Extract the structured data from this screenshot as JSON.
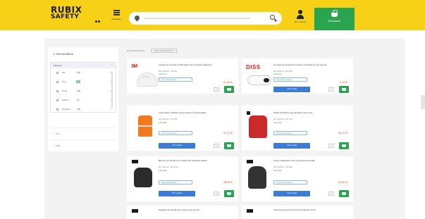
{
  "brand": {
    "line1": "RUBIX",
    "line2": "SAFETY"
  },
  "header": {
    "catalog_label": "Catalogue",
    "account_label": "Mon compte",
    "cart_label": "Mon panier"
  },
  "colors": {
    "header_bg": "#f7d117",
    "accent_green": "#2aa44f",
    "link_blue": "#3c7bd6",
    "price_red": "#e05030"
  },
  "filters": {
    "title": "Trier les filtres",
    "group_label": "Marques",
    "options": [
      {
        "label": "3M",
        "count": "12",
        "highlight": false
      },
      {
        "label": "Diss",
        "count": "8",
        "highlight": true
      },
      {
        "label": "Delta",
        "count": "14",
        "highlight": false
      },
      {
        "label": "Kapriol",
        "count": "6",
        "highlight": false
      },
      {
        "label": "Portwest",
        "count": "21",
        "highlight": false
      }
    ],
    "collapsed": [
      "Prix",
      "Taille"
    ]
  },
  "sortbar": {
    "results": "32 produits trouvés",
    "sort": "Trier par pertinence ▾"
  },
  "products": [
    {
      "brand": "3M",
      "title": "Casque de sécurité ventilé blanc avec lunettes intégrées",
      "sub": "Réf. fabricant : 3M-V9A",
      "stock": "En stock",
      "tag": "Voir la fiche produit",
      "price": "31,56 €",
      "detail": "Voir le détail",
      "qty": "1"
    },
    {
      "brand": "DISS",
      "title": "Lunettes de protection incolores anti-buée et anti-rayures",
      "sub": "Réf. fabricant : DS-0201",
      "stock": "En stock",
      "tag": "Voir la fiche produit",
      "price": "4,92 €",
      "detail": "Voir le détail",
      "qty": "1"
    },
    {
      "brand": "",
      "title": "Veste haute visibilité orange classe 3 imperméable",
      "sub": "Réf. fabricant : HV-3310",
      "stock": "En stock",
      "tag": "Voir la fiche produit",
      "price": "41,23 €",
      "detail": "Voir le détail",
      "qty": "1"
    },
    {
      "brand": "",
      "title": "Parka softshell rouge doublée coupe-vent",
      "sub": "Réf. fabricant : PK-7721",
      "stock": "En stock",
      "tag": "Voir la fiche produit",
      "price": "56,10 €",
      "detail": "Voir le détail",
      "qty": "1"
    },
    {
      "brand": "",
      "title": "Blouson de travail noir multipoches doublure polaire",
      "sub": "Réf. fabricant : BW-1140",
      "stock": "En stock",
      "tag": "Voir la fiche produit",
      "price": "48,95 €",
      "detail": "Voir le détail",
      "qty": "1"
    },
    {
      "brand": "",
      "title": "Veste matelassée noire à capuche amovible",
      "sub": "Réf. fabricant : VM-2290",
      "stock": "En stock",
      "tag": "Voir la fiche produit",
      "price": "52,80 €",
      "detail": "Voir le détail",
      "qty": "1"
    },
    {
      "brand": "",
      "title": "Pantalon de travail gris renforcé aux genoux",
      "sub": "",
      "stock": "",
      "tag": "",
      "price": "",
      "detail": "",
      "qty": ""
    },
    {
      "brand": "",
      "title": "Chaussures de sécurité S3 montantes noires",
      "sub": "",
      "stock": "",
      "tag": "",
      "price": "",
      "detail": "",
      "qty": ""
    }
  ]
}
